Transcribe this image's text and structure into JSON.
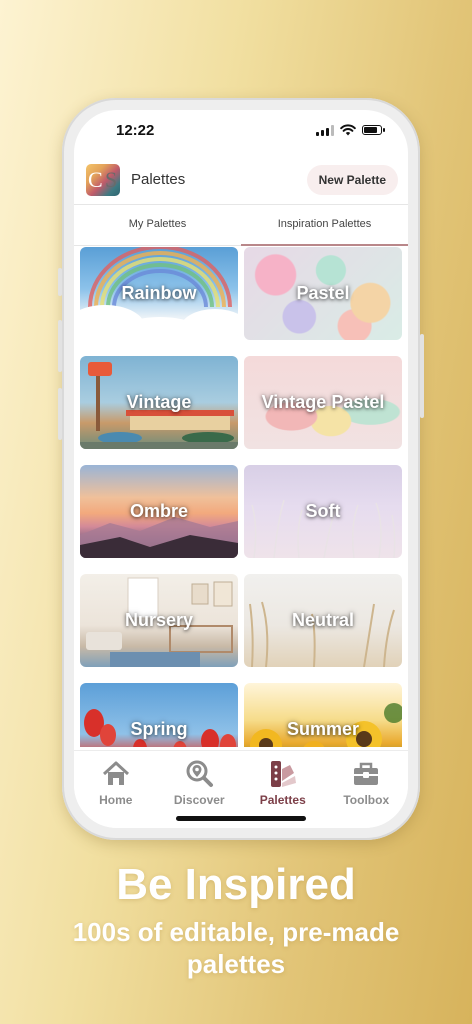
{
  "status_bar": {
    "time": "12:22"
  },
  "header": {
    "title": "Palettes",
    "new_palette_label": "New Palette",
    "logo_text_c": "C",
    "logo_text_s": "S"
  },
  "tabs": [
    {
      "label": "My Palettes",
      "active": false
    },
    {
      "label": "Inspiration Palettes",
      "active": true
    }
  ],
  "palettes": [
    {
      "label": "Rainbow"
    },
    {
      "label": "Pastel"
    },
    {
      "label": "Vintage"
    },
    {
      "label": "Vintage Pastel"
    },
    {
      "label": "Ombre"
    },
    {
      "label": "Soft"
    },
    {
      "label": "Nursery"
    },
    {
      "label": "Neutral"
    },
    {
      "label": "Spring"
    },
    {
      "label": "Summer"
    }
  ],
  "tabbar": [
    {
      "label": "Home",
      "icon": "home-icon",
      "active": false
    },
    {
      "label": "Discover",
      "icon": "discover-icon",
      "active": false
    },
    {
      "label": "Palettes",
      "icon": "palettes-icon",
      "active": true
    },
    {
      "label": "Toolbox",
      "icon": "toolbox-icon",
      "active": false
    }
  ],
  "promo": {
    "headline": "Be Inspired",
    "subline": "100s of editable, pre-made palettes"
  },
  "colors": {
    "accent": "#7c3f48",
    "tab_underline": "#b9878a",
    "button_bg": "#f8eeee"
  }
}
